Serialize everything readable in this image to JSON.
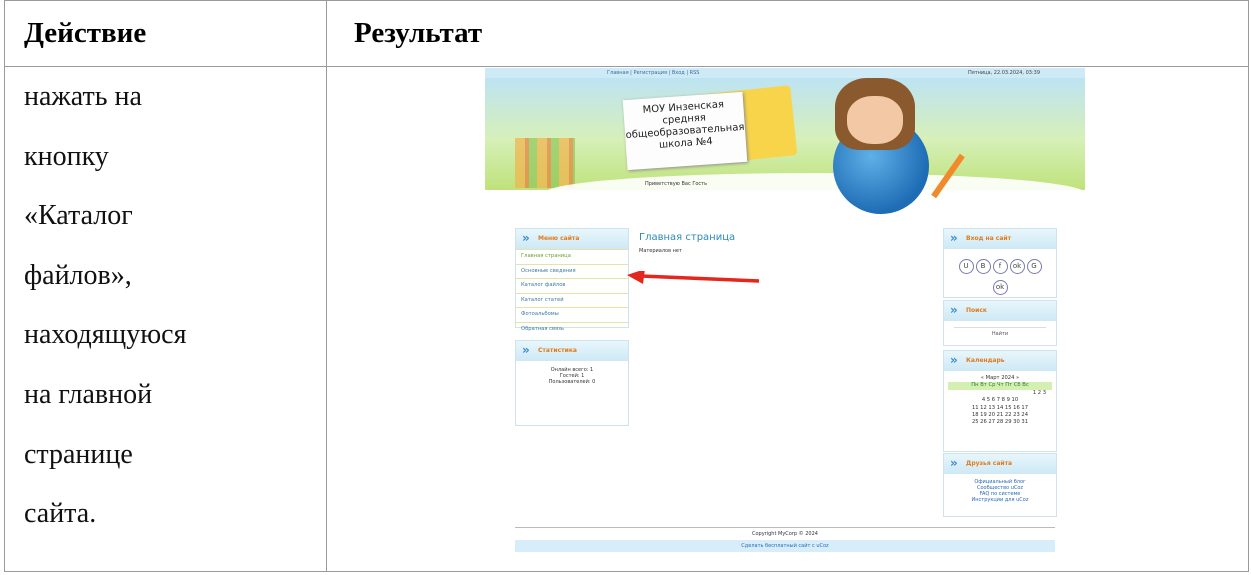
{
  "table": {
    "header_action": "Действие",
    "header_result": "Результат",
    "action_lines": [
      "нажать на",
      "кнопку",
      "«Каталог",
      "файлов»,",
      "находящуюся",
      "на главной",
      "странице",
      "сайта."
    ]
  },
  "screenshot": {
    "top_links": "Главная | Регистрация | Вход | RSS",
    "date": "Пятница, 22.03.2024, 03:39",
    "site_title": "МОУ Инзенская средняя общеобразовательная школа №4",
    "greeting": "Приветствую Вас Гость",
    "menu_title": "Меню сайта",
    "menu_items": [
      "Главная страница",
      "Основные сведения",
      "Каталог файлов",
      "Каталог статей",
      "Фотоальбомы",
      "Обратная связь"
    ],
    "stats_title": "Статистика",
    "stats_lines": [
      "Онлайн всего: 1",
      "Гостей: 1",
      "Пользователей: 0"
    ],
    "page_title": "Главная страница",
    "page_note": "Материалов нет",
    "login_title": "Вход на сайт",
    "login_icons": [
      "U",
      "B",
      "f",
      "ok",
      "G",
      "ok"
    ],
    "search_title": "Поиск",
    "search_button": "Найти",
    "calendar_title": "Календарь",
    "calendar_month": "« Март 2024 »",
    "calendar_weekdays": "Пн Вт Ср Чт Пт Сб Вс",
    "calendar_rows": [
      "1 2 3",
      "4 5 6 7 8 9 10",
      "11 12 13 14 15 16 17",
      "18 19 20 21 22 23 24",
      "25 26 27 28 29 30 31"
    ],
    "friends_title": "Друзья сайта",
    "friends_links": [
      "Официальный блог",
      "Сообщество uCoz",
      "FAQ по системе",
      "Инструкции для uCoz"
    ],
    "footer_copyright": "Copyright MyCorp © 2024",
    "footer_link": "Сделать бесплатный сайт с uCoz",
    "arrow_color": "#e3261e"
  }
}
